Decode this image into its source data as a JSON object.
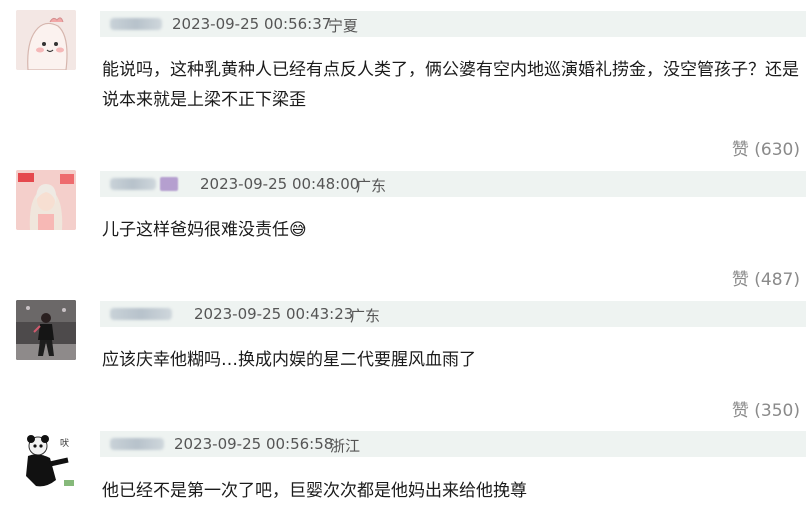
{
  "comments": [
    {
      "timestamp": "2023-09-25 00:56:37",
      "location": "宁夏",
      "text": "能说吗，这种乳黄种人已经有点反人类了，俩公婆有空内地巡演婚礼捞金，没空管孩子？还是说本来就是上梁不正下梁歪",
      "likes_label": "赞 (630)"
    },
    {
      "timestamp": "2023-09-25 00:48:00",
      "location": "广东",
      "text": "儿子这样爸妈很难没责任",
      "likes_label": "赞 (487)"
    },
    {
      "timestamp": "2023-09-25 00:43:23",
      "location": "广东",
      "text": "应该庆幸他糊吗…换成内娱的星二代要腥风血雨了",
      "likes_label": "赞 (350)"
    },
    {
      "timestamp": "2023-09-25 00:56:58",
      "location": "浙江",
      "text": "他已经不是第一次了吧，巨婴次次都是他妈出来给他挽尊",
      "likes_label": ""
    }
  ],
  "emoji": {
    "sweat_smile": "😅"
  }
}
